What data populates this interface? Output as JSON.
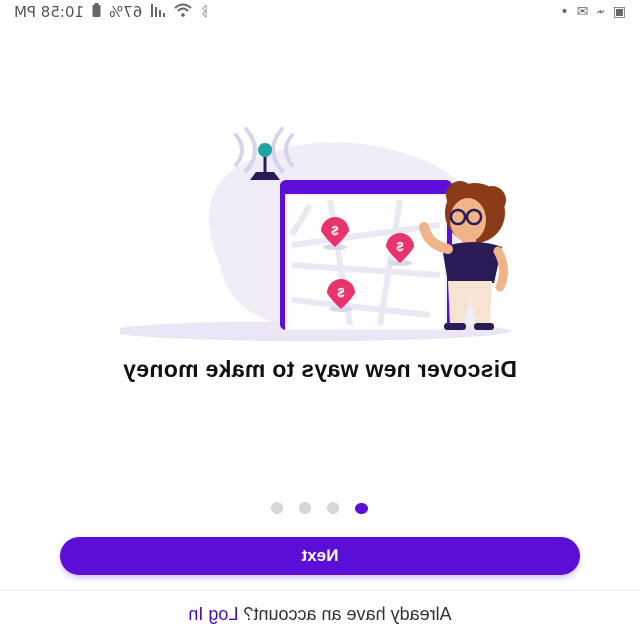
{
  "status_bar": {
    "time": "10:58 PM",
    "battery": "67%",
    "left_icons": [
      "photo-icon",
      "usb-icon",
      "mail-icon",
      "more-icon"
    ],
    "right_icons": [
      "bluetooth-icon",
      "wifi-icon",
      "signal-icon",
      "battery-icon"
    ]
  },
  "onboarding": {
    "title": "Discover new ways to make money",
    "page_count": 4,
    "active_page": 1
  },
  "actions": {
    "next_label": "Next"
  },
  "footer": {
    "prompt": "Already have an account?",
    "login_label": "Log In"
  },
  "colors": {
    "primary": "#5b0fd6",
    "pin": "#e8336d",
    "dot_inactive": "#d6d6d6"
  }
}
